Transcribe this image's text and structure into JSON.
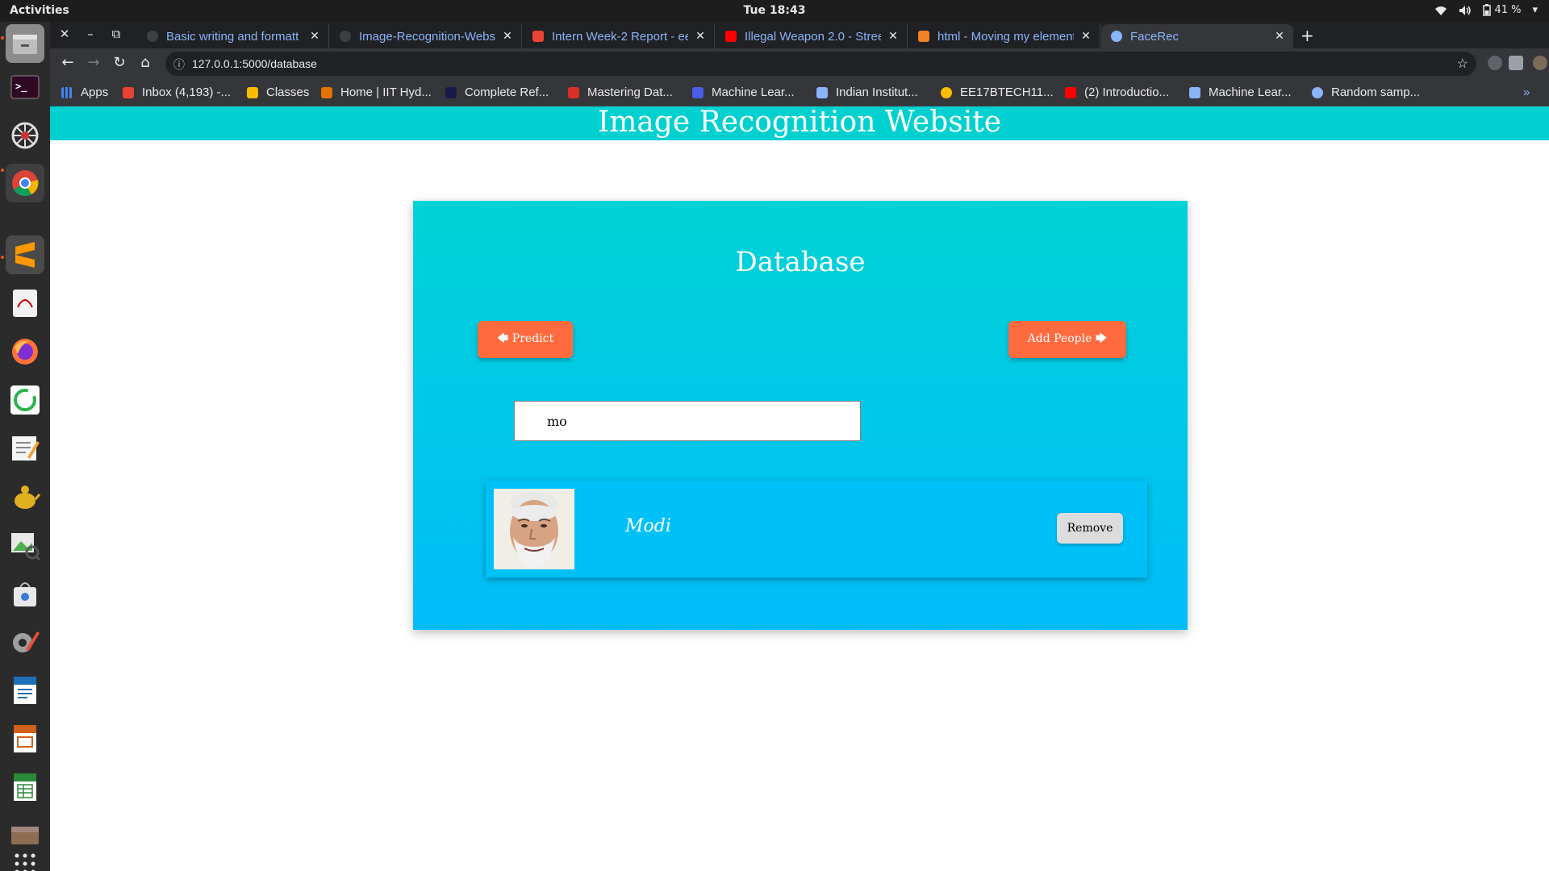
{
  "system_bar": {
    "activities": "Activities",
    "clock": "Tue 18:43",
    "battery": "41 %",
    "icons": [
      "wifi-icon",
      "volume-icon",
      "battery-icon",
      "chevron-down-icon"
    ]
  },
  "dock": {
    "apps": [
      "files",
      "terminal",
      "network-tool",
      "chrome",
      "sublime-text",
      "evince",
      "firefox",
      "app-circle",
      "text-editor",
      "python-teapot",
      "image-viewer",
      "store",
      "settings",
      "writer",
      "impress",
      "calc",
      "archive",
      "show-apps"
    ]
  },
  "browser": {
    "tabs": [
      {
        "title": "Basic writing and formatt",
        "favicon": "github-icon",
        "color": "#3c4043"
      },
      {
        "title": "Image-Recognition-Webs",
        "favicon": "github-icon",
        "color": "#3c4043"
      },
      {
        "title": "Intern Week-2 Report - ee",
        "favicon": "gmail-icon",
        "color": "#ea4335"
      },
      {
        "title": "Illegal Weapon 2.0 - Street",
        "favicon": "youtube-icon",
        "color": "#ff0000"
      },
      {
        "title": "html - Moving my element",
        "favicon": "stackoverflow-icon",
        "color": "#f48024"
      },
      {
        "title": "FaceRec",
        "favicon": "globe-icon",
        "color": "#8ab4f8"
      }
    ],
    "address": "127.0.0.1:5000/database",
    "bookmarks": [
      {
        "label": "Apps",
        "color": "#4285f4"
      },
      {
        "label": "Inbox (4,193) -...",
        "color": "#ea4335"
      },
      {
        "label": "Classes",
        "color": "#fbbc04"
      },
      {
        "label": "Home | IIT Hyd...",
        "color": "#e37400"
      },
      {
        "label": "Complete Ref...",
        "color": "#1a1a4a"
      },
      {
        "label": "Mastering Dat...",
        "color": "#d93025"
      },
      {
        "label": "Machine Lear...",
        "color": "#4a5ee8"
      },
      {
        "label": "Indian Institut...",
        "color": "#8ab4f8"
      },
      {
        "label": "EE17BTECH11...",
        "color": "#fbbc04"
      },
      {
        "label": "(2) Introductio...",
        "color": "#ff0000"
      },
      {
        "label": "Machine Lear...",
        "color": "#8ab4f8"
      },
      {
        "label": "Random samp...",
        "color": "#8ab4f8"
      }
    ]
  },
  "site": {
    "header": "Image Recognition Website",
    "panel_title": "Database",
    "predict_button": "Predict",
    "add_people_button": "Add People",
    "search_value": "mo",
    "people": [
      {
        "name": "Modi",
        "remove_label": "Remove"
      }
    ],
    "colors": {
      "header_bg": "#00d0d0",
      "panel_top": "#00d3d6",
      "panel_bottom": "#00bdfa",
      "button_orange": "#ff6b3f",
      "remove_gray": "#dcdcdc"
    }
  }
}
